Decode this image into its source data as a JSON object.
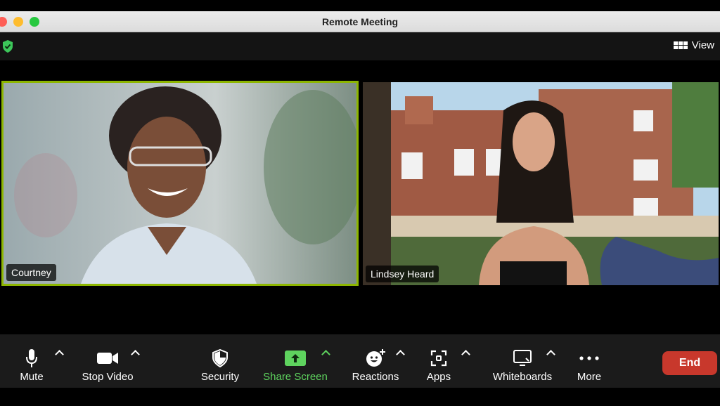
{
  "window": {
    "title": "Remote Meeting"
  },
  "topbar": {
    "view_label": "View"
  },
  "participants": [
    {
      "name": "Courtney",
      "active_speaker": true
    },
    {
      "name": "Lindsey Heard",
      "active_speaker": false
    }
  ],
  "toolbar": {
    "mute_label": "Mute",
    "stop_video_label": "Stop Video",
    "security_label": "Security",
    "share_screen_label": "Share Screen",
    "reactions_label": "Reactions",
    "apps_label": "Apps",
    "whiteboards_label": "Whiteboards",
    "more_label": "More",
    "end_label": "End"
  },
  "colors": {
    "active_speaker_border": "#8db600",
    "share_green": "#5ed35e",
    "end_red": "#c8382c",
    "shield_green": "#3cc65a"
  },
  "icons": [
    "shield-check-icon",
    "view-grid-icon",
    "microphone-icon",
    "video-camera-icon",
    "security-shield-icon",
    "share-screen-icon",
    "reactions-icon",
    "apps-icon",
    "whiteboard-icon",
    "more-dots-icon"
  ]
}
